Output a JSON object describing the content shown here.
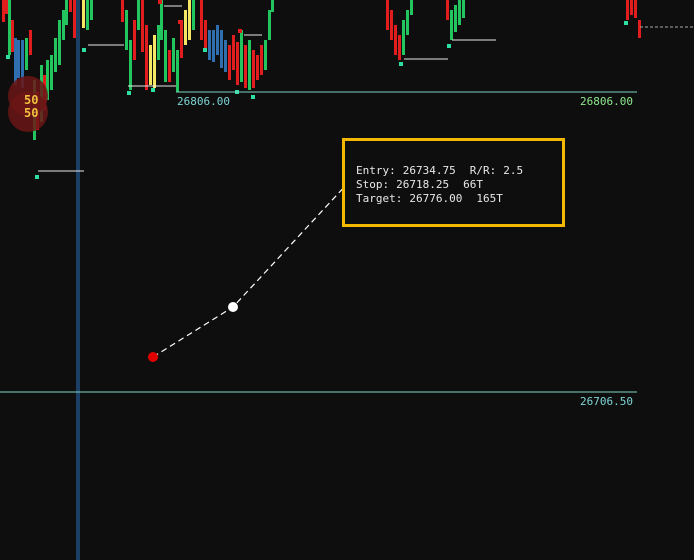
{
  "colors": {
    "background": "#0e0e0e",
    "up_bar": "#22c55e",
    "down_bar": "#e11d1d",
    "neutral_bar": "#2f6fb0",
    "highlight_bar": "#f5e663",
    "level_line": "#7fd4c4",
    "level_label_cyan": "#7fd4d4",
    "level_label_green": "#8ee88e",
    "vertical_cursor": "#1c3f66",
    "info_box_border": "#f5b800",
    "entry_point": "#22cc22",
    "stop_point": "#e00000",
    "mid_point": "#ffffff",
    "bubble": "#6b1515",
    "bubble_text": "#f0c040"
  },
  "levels": [
    {
      "price": "26806.00",
      "left_label": "26806.00",
      "right_label": "26806.00"
    },
    {
      "price": "26706.50",
      "right_label": "26706.50"
    }
  ],
  "volume_bubble": {
    "top": "50",
    "bottom": "50"
  },
  "trade": {
    "entry_label": "Entry:",
    "entry": "26734.75",
    "rr_label": "R/R:",
    "rr": "2.5",
    "stop_label": "Stop:",
    "stop": "26718.25",
    "stop_ticks": "66T",
    "target_label": "Target:",
    "target": "26776.00",
    "target_ticks": "165T"
  },
  "icons": {
    "entry_point": "entry-point-icon",
    "stop_point": "stop-point-icon",
    "mid_point": "drag-handle-icon"
  }
}
